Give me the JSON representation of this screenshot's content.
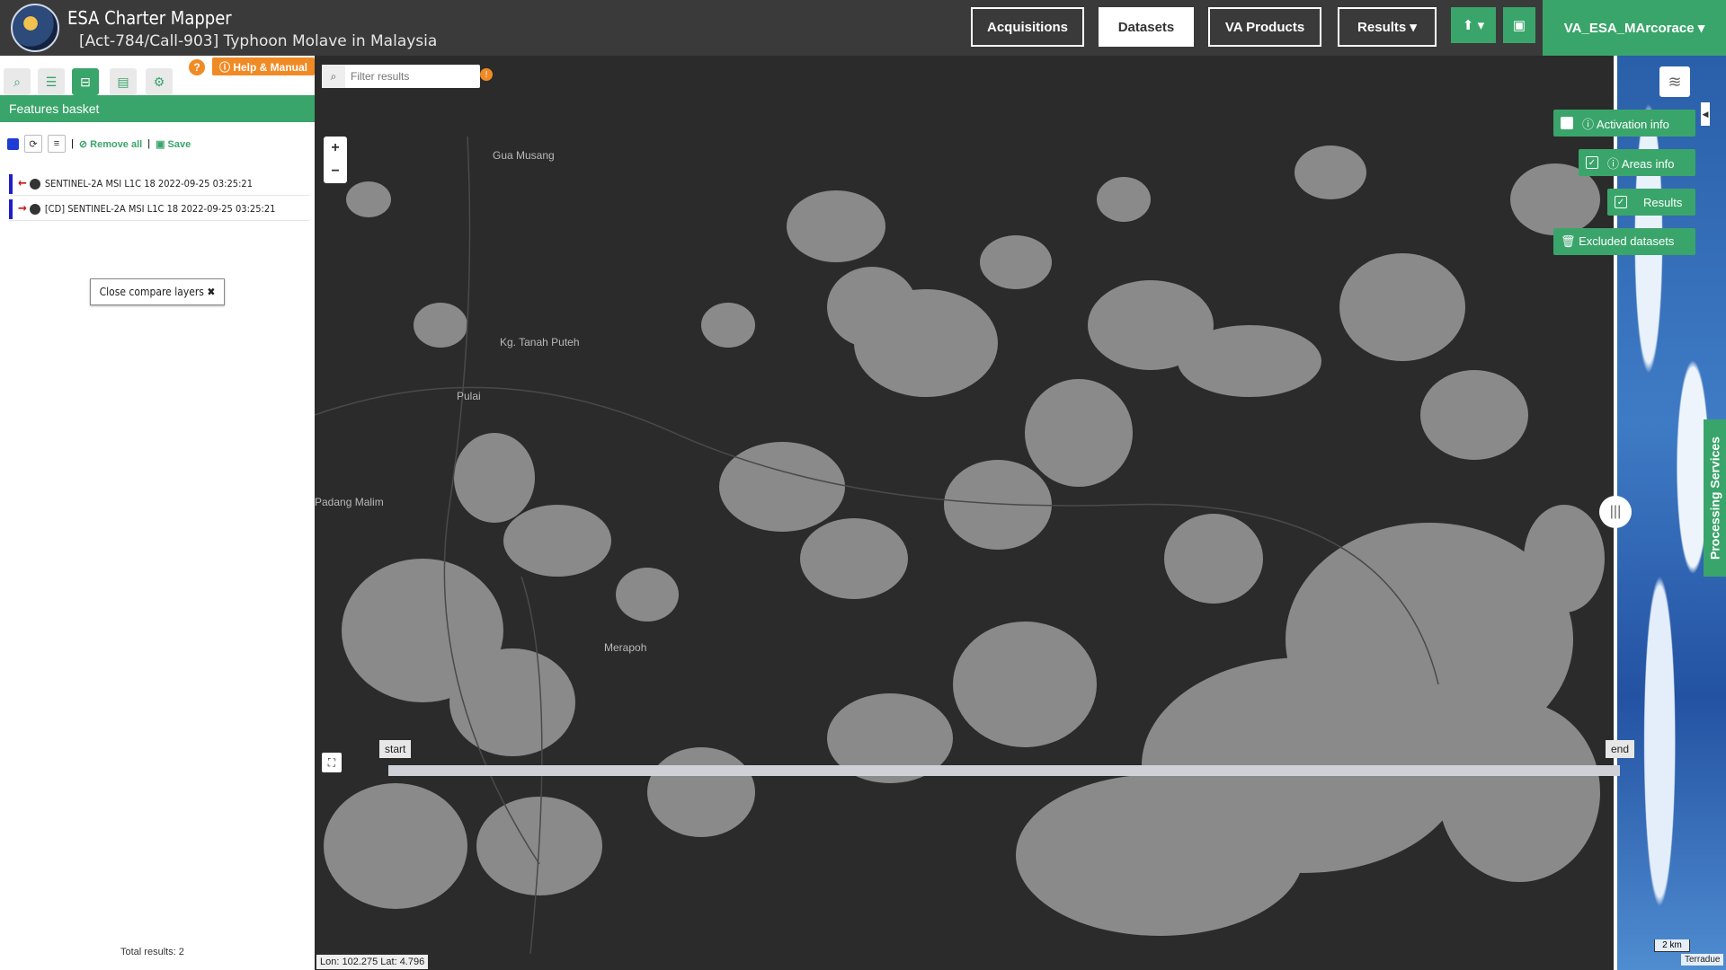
{
  "header": {
    "app_title": "ESA Charter Mapper",
    "subtitle": "[Act-784/Call-903] Typhoon Molave in Malaysia",
    "nav": [
      "Acquisitions",
      "Datasets",
      "VA Products",
      "Results ▾"
    ],
    "active_nav": "Datasets",
    "upload_label": "⬆ ▾",
    "briefcase_label": "▣",
    "user": "VA_ESA_MArcorace ▾"
  },
  "sidebar": {
    "help_q": "?",
    "help_label": "ⓘ Help & Manual",
    "panel_title": "Features basket",
    "remove_all": "⊘ Remove all",
    "save": "▣ Save",
    "sep1": "|",
    "sep2": "|",
    "items": [
      {
        "arrow": "←",
        "label": "SENTINEL-2A MSI L1C 18 2022-09-25 03:25:21"
      },
      {
        "arrow": "→",
        "label": "[CD] SENTINEL-2A MSI L1C 18 2022-09-25 03:25:21"
      }
    ],
    "close_compare": "Close compare layers ✖",
    "total_results": "Total results: 2",
    "collapse_arrow": "◀"
  },
  "map": {
    "filter_placeholder": "Filter results",
    "filter_info": "!",
    "zoom_in": "+",
    "zoom_out": "−",
    "places": [
      "Gua Musang",
      "Kg. Tanah Puteh",
      "Pulai",
      "Padang Malim",
      "Merapoh"
    ],
    "panels": {
      "activation_info": "ⓘ Activation info",
      "areas_info": "ⓘ Areas info",
      "results": "Results",
      "excluded": "🗑 Excluded datasets"
    },
    "processing_services": "Processing Services",
    "timeline": {
      "start": "start",
      "end": "end"
    },
    "coords": "Lon: 102.275 Lat: 4.796",
    "scale": "2 km",
    "attribution": "Terradue",
    "split_handle": "|||",
    "panel_arrow": "◀"
  }
}
